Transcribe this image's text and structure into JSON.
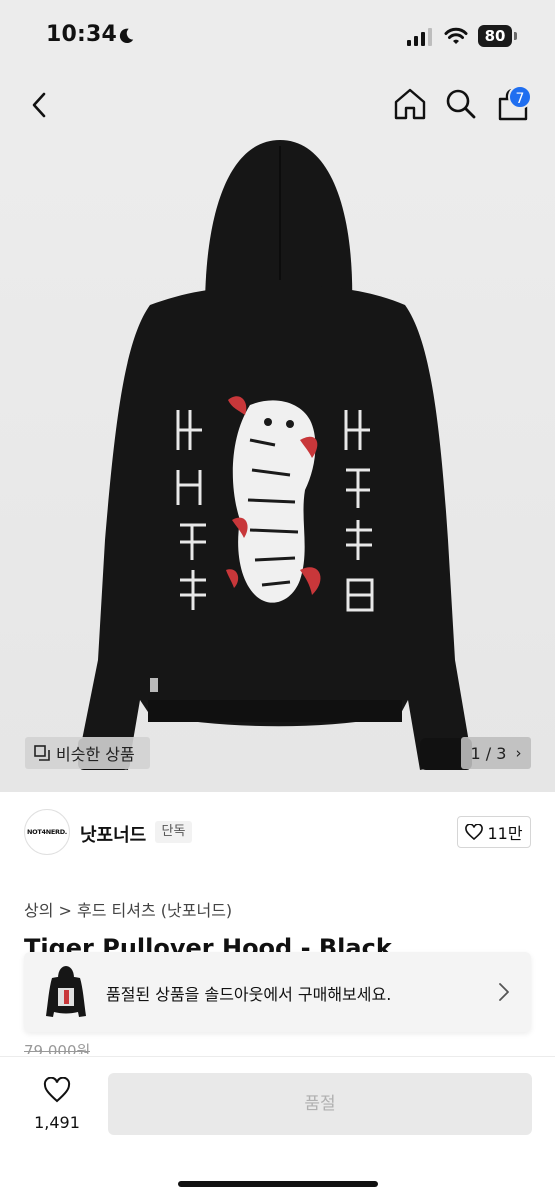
{
  "status_bar": {
    "time": "10:34",
    "battery": "80"
  },
  "nav": {
    "cart_count": "7"
  },
  "image": {
    "similar_label": "비슷한 상품",
    "pager": "1 / 3"
  },
  "brand": {
    "logo_text": "NOT4NERD.",
    "name": "낫포너드",
    "tag": "단독",
    "likes": "11만"
  },
  "breadcrumb": "상의 > 후드 티셔츠 (낫포너드)",
  "product": {
    "title": "Tiger Pullover Hood - Black",
    "original_price": "79,000원"
  },
  "soldout_banner": {
    "text": "품절된 상품을 솔드아웃에서 구매해보세요."
  },
  "bottom_bar": {
    "wish_count": "1,491",
    "buy_label": "품절"
  },
  "colors": {
    "accent": "#1f6ef0",
    "disabled": "#e9e9e9"
  }
}
